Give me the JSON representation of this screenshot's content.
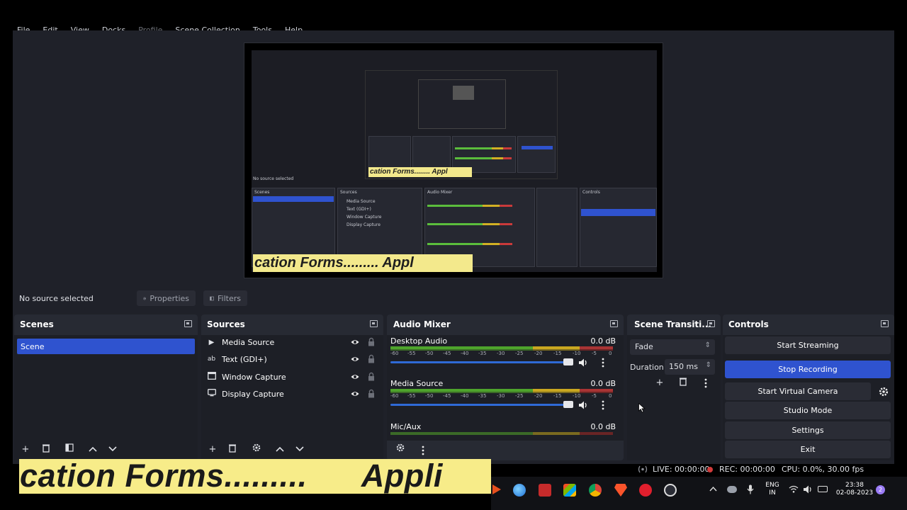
{
  "menu": {
    "items": [
      "File",
      "Edit",
      "View",
      "Docks",
      "Profile",
      "Scene Collection",
      "Tools",
      "Help"
    ]
  },
  "source_bar": {
    "no_source": "No source selected",
    "properties": "Properties",
    "filters": "Filters"
  },
  "scenes": {
    "title": "Scenes",
    "items": [
      "Scene"
    ]
  },
  "sources": {
    "title": "Sources",
    "items": [
      {
        "label": "Media Source",
        "icon": "play-icon"
      },
      {
        "label": "Text (GDI+)",
        "icon": "text-icon"
      },
      {
        "label": "Window Capture",
        "icon": "window-icon"
      },
      {
        "label": "Display Capture",
        "icon": "monitor-icon"
      }
    ]
  },
  "mixer": {
    "title": "Audio Mixer",
    "channels": [
      {
        "name": "Desktop Audio",
        "db": "0.0 dB"
      },
      {
        "name": "Media Source",
        "db": "0.0 dB"
      },
      {
        "name": "Mic/Aux",
        "db": "0.0 dB"
      }
    ],
    "ticks": [
      "-60",
      "-55",
      "-50",
      "-45",
      "-40",
      "-35",
      "-30",
      "-25",
      "-20",
      "-15",
      "-10",
      "-5",
      "0"
    ]
  },
  "transitions": {
    "title": "Scene Transiti...",
    "selected": "Fade",
    "duration_label": "Duration",
    "duration_value": "150 ms"
  },
  "controls": {
    "title": "Controls",
    "start_streaming": "Start Streaming",
    "stop_recording": "Stop Recording",
    "start_virtual_camera": "Start Virtual Camera",
    "studio_mode": "Studio Mode",
    "settings": "Settings",
    "exit": "Exit"
  },
  "status": {
    "live": "LIVE: 00:00:00",
    "rec": "REC: 00:00:00",
    "cpu": "CPU: 0.0%, 30.00 fps"
  },
  "ticker": {
    "text": "cation Forms.........      Appli"
  },
  "preview": {
    "ticker_small": "cation Forms.........      Appl",
    "ticker_mini": "cation Forms........    Appl"
  },
  "taskbar": {
    "lang_top": "ENG",
    "lang_bottom": "IN",
    "time": "23:38",
    "date": "02-08-2023",
    "badge": "2"
  },
  "colors": {
    "accent": "#2f53cf",
    "panel": "#272a33",
    "dock_body": "#1d1f26",
    "ticker_bg": "#f7ec89"
  }
}
